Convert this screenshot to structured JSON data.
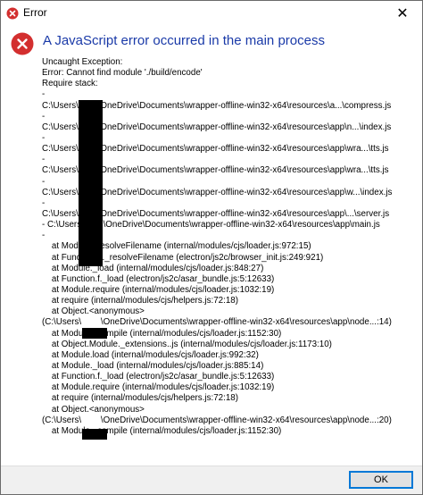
{
  "window": {
    "title": "Error",
    "close_glyph": "✕"
  },
  "dialog": {
    "icon": "error-circle-icon",
    "main_instruction": "A JavaScript error occurred in the main process",
    "ok_label": "OK",
    "accent_color": "#1a3aa8",
    "error_color": "#d32f2f"
  },
  "log_lines": [
    "Uncaught Exception:",
    "Error: Cannot find module './build/encode'",
    "Require stack:",
    "-",
    "C:\\Users\\        \\OneDrive\\Documents\\wrapper-offline-win32-x64\\resources\\a...\\compress.js",
    "-",
    "C:\\Users\\        \\OneDrive\\Documents\\wrapper-offline-win32-x64\\resources\\app\\n...\\index.js",
    "-",
    "C:\\Users\\        \\OneDrive\\Documents\\wrapper-offline-win32-x64\\resources\\app\\wra...\\tts.js",
    "-",
    "C:\\Users\\        \\OneDrive\\Documents\\wrapper-offline-win32-x64\\resources\\app\\wra...\\tts.js",
    "-",
    "C:\\Users\\        \\OneDrive\\Documents\\wrapper-offline-win32-x64\\resources\\app\\w...\\index.js",
    "-",
    "C:\\Users\\        \\OneDrive\\Documents\\wrapper-offline-win32-x64\\resources\\app\\...\\server.js",
    "- C:\\Users\\        \\OneDrive\\Documents\\wrapper-offline-win32-x64\\resources\\app\\main.js",
    "-",
    "    at Module._resolveFilename (internal/modules/cjs/loader.js:972:15)",
    "    at Function.n._resolveFilename (electron/js2c/browser_init.js:249:921)",
    "    at Module._load (internal/modules/cjs/loader.js:848:27)",
    "    at Function.f._load (electron/js2c/asar_bundle.js:5:12633)",
    "    at Module.require (internal/modules/cjs/loader.js:1032:19)",
    "    at require (internal/modules/cjs/helpers.js:72:18)",
    "    at Object.<anonymous>",
    "(C:\\Users\\        \\OneDrive\\Documents\\wrapper-offline-win32-x64\\resources\\app\\node...:14)",
    "    at Module._compile (internal/modules/cjs/loader.js:1152:30)",
    "    at Object.Module._extensions..js (internal/modules/cjs/loader.js:1173:10)",
    "    at Module.load (internal/modules/cjs/loader.js:992:32)",
    "    at Module._load (internal/modules/cjs/loader.js:885:14)",
    "    at Function.f._load (electron/js2c/asar_bundle.js:5:12633)",
    "    at Module.require (internal/modules/cjs/loader.js:1032:19)",
    "    at require (internal/modules/cjs/helpers.js:72:18)",
    "    at Object.<anonymous>",
    "(C:\\Users\\        \\OneDrive\\Documents\\wrapper-offline-win32-x64\\resources\\app\\node...:20)",
    "    at Module._compile (internal/modules/cjs/loader.js:1152:30)"
  ]
}
